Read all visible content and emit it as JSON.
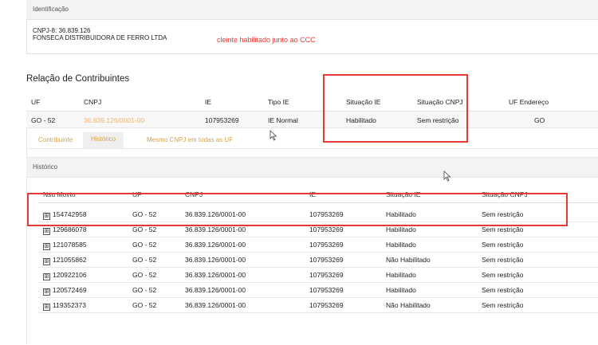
{
  "identificacao": {
    "title": "Identificação",
    "cnpj_line": "CNPJ-8: 36.839.126",
    "company": "FONSECA DISTRIBUIDORA DE FERRO LTDA",
    "note": "cleinte habilitado junto ao CCC"
  },
  "section_title": "Relação de Contribuintes",
  "main_table": {
    "headers": [
      "UF",
      "CNPJ",
      "IE",
      "Tipo IE",
      "Situação IE",
      "Situação CNPJ",
      "UF Endereço"
    ],
    "row": [
      "GO - 52",
      "36.839.126/0001-00",
      "107953269",
      "IE Normal",
      "Habilitado",
      "Sem restrição",
      "GO"
    ]
  },
  "tabs": [
    "Contribuinte",
    "Histórico",
    "Mesmo CNPJ em todas as UF"
  ],
  "historico": {
    "title": "Histórico",
    "headers": [
      "Nsu Movto",
      "UF",
      "CNPJ",
      "IE",
      "Situação IE",
      "Situação CNPJ"
    ],
    "rows": [
      [
        "154742958",
        "GO - 52",
        "36.839.126/0001-00",
        "107953269",
        "Habilitado",
        "Sem restrição"
      ],
      [
        "129686078",
        "GO - 52",
        "36.839.126/0001-00",
        "107953269",
        "Habilitado",
        "Sem restrição"
      ],
      [
        "121078585",
        "GO - 52",
        "36.839.126/0001-00",
        "107953269",
        "Habilitado",
        "Sem restrição"
      ],
      [
        "121055862",
        "GO - 52",
        "36.839.126/0001-00",
        "107953269",
        "Não Habilitado",
        "Sem restrição"
      ],
      [
        "120922106",
        "GO - 52",
        "36.839.126/0001-00",
        "107953269",
        "Habilitado",
        "Sem restrição"
      ],
      [
        "120572469",
        "GO - 52",
        "36.839.126/0001-00",
        "107953269",
        "Habilitado",
        "Sem restrição"
      ],
      [
        "119352373",
        "GO - 52",
        "36.839.126/0001-00",
        "107953269",
        "Não Habilitado",
        "Sem restrição"
      ]
    ]
  },
  "expand_symbol": "⊞",
  "colors": {
    "highlight": "#e53935",
    "tab_text": "#d4a24a",
    "cnpj_link": "#f2b46b"
  }
}
